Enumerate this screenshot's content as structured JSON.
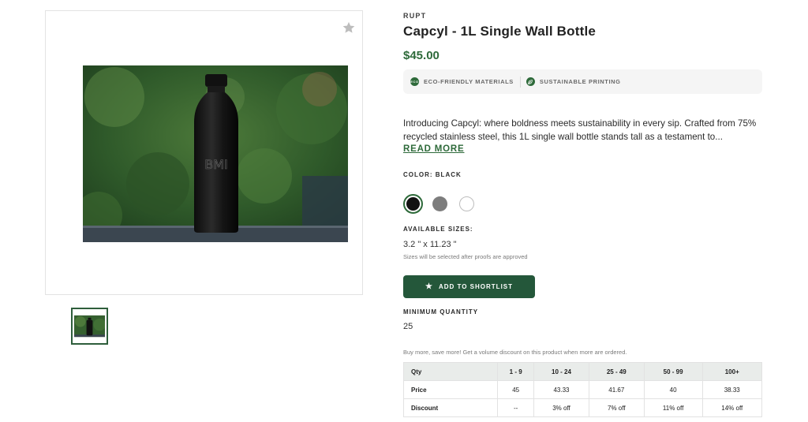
{
  "product": {
    "vendor": "RUPT",
    "title": "Capcyl - 1L Single Wall Bottle",
    "price": "$45.00",
    "description": "Introducing Capcyl: where boldness meets sustainability in every sip. Crafted from 75% recycled stainless steel, this 1L single wall bottle stands tall as a testament to...",
    "read_more": "READ MORE"
  },
  "badges": [
    {
      "label": "ECO-FRIENDLY MATERIALS",
      "icon": "eco-badge-icon",
      "icon_text": "ECO"
    },
    {
      "label": "SUSTAINABLE PRINTING",
      "icon": "leaf-icon"
    }
  ],
  "color": {
    "label": "COLOR: BLACK",
    "options": [
      {
        "name": "black",
        "hex": "#121212",
        "selected": true
      },
      {
        "name": "grey",
        "hex": "#7d7d7d",
        "selected": false
      },
      {
        "name": "white",
        "hex": "#ffffff",
        "selected": false
      }
    ]
  },
  "sizes": {
    "label": "AVAILABLE SIZES:",
    "value": "3.2 \" x 11.23 \"",
    "note": "Sizes will be selected after proofs are approved"
  },
  "shortlist_button": "ADD TO SHORTLIST",
  "minimum_quantity": {
    "label": "MINIMUM QUANTITY",
    "value": "25"
  },
  "promo": "Buy more, save more! Get a volume discount on this product when more are ordered.",
  "pricing_table": {
    "headers": [
      "Qty",
      "1 - 9",
      "10 - 24",
      "25 - 49",
      "50 - 99",
      "100+"
    ],
    "rows": [
      [
        "Price",
        "45",
        "43.33",
        "41.67",
        "40",
        "38.33"
      ],
      [
        "Discount",
        "--",
        "3% off",
        "7% off",
        "11% off",
        "14% off"
      ]
    ]
  },
  "colors": {
    "accent": "#2e6a3a",
    "button": "#24573a"
  },
  "icons": [
    "star-icon",
    "eco-badge-icon",
    "leaf-icon"
  ]
}
